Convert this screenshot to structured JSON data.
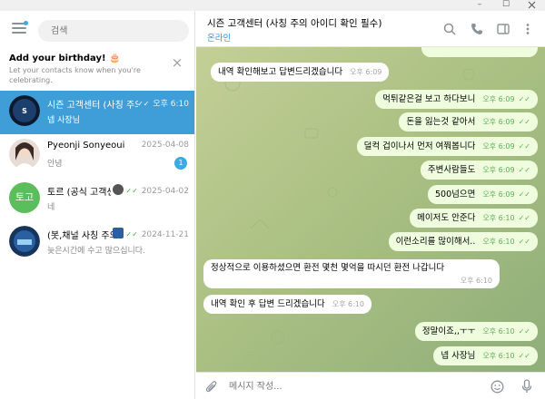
{
  "window": {
    "minimize": "–",
    "maximize": "☐"
  },
  "sidebar": {
    "search_placeholder": "검색",
    "birthday": {
      "title": "Add your birthday! 🎂",
      "text": "Let your contacts know when you're celebrating."
    },
    "chats": [
      {
        "name": "시즌 고객센터 (사칭 주의 아이디 확인 필수)",
        "time": "오후 6:10",
        "message": "넵 사장님",
        "active": true,
        "read": true
      },
      {
        "name": "Pyeonji Sonyeoui",
        "time": "2025-04-08",
        "message": "안녕",
        "unread": "1"
      },
      {
        "name": "토르 (공식 고객센터)",
        "avatar_text": "토고",
        "time": "2025-04-02",
        "message": "네",
        "read": true
      },
      {
        "name": "(봇,채널 사칭 주의)",
        "time": "2024-11-21",
        "message": "늦은시간에 수고 많으십니다.",
        "read": true
      }
    ]
  },
  "header": {
    "title": "시즌 고객센터 (사칭 주의 아이디 확인 필수)",
    "status": "온라인"
  },
  "messages": [
    {
      "dir": "in",
      "text": "내역 확인해보고 답변드리겠습니다",
      "time": "오후 6:09"
    },
    {
      "dir": "out",
      "text": "먹튀같은걸 보고 하다보니",
      "time": "오후 6:09"
    },
    {
      "dir": "out",
      "text": "돈을 잃는것 같아서",
      "time": "오후 6:09"
    },
    {
      "dir": "out",
      "text": "덜컥 겁이나서 먼저 여쭤봅니다",
      "time": "오후 6:09"
    },
    {
      "dir": "out",
      "text": "주변사람들도",
      "time": "오후 6:09"
    },
    {
      "dir": "out",
      "text": "500넘으면",
      "time": "오후 6:09"
    },
    {
      "dir": "out",
      "text": "메이저도 안준다",
      "time": "오후 6:10"
    },
    {
      "dir": "out",
      "text": "이런소리를 많이해서..",
      "time": "오후 6:10"
    },
    {
      "dir": "in",
      "text": "정상적으로 이용하셨으면 환전 몇천 몇억을 따시던 환전 나갑니다",
      "time": "오후 6:10"
    },
    {
      "dir": "in",
      "text": "내역 확인 후 답변 드리겠습니다",
      "time": "오후 6:10"
    },
    {
      "dir": "out",
      "text": "정말이죠,,ㅜㅜ",
      "time": "오후 6:10"
    },
    {
      "dir": "out",
      "text": "넵 사장님",
      "time": "오후 6:10"
    }
  ],
  "composer": {
    "placeholder": "메시지 작성..."
  },
  "colors": {
    "accent": "#3f9ed8",
    "chat_bg": "#b5c58b",
    "out_bubble": "#effdde",
    "read_check": "#5fae59"
  },
  "icons": [
    "menu-icon",
    "close-icon",
    "search-icon",
    "phone-icon",
    "sidebar-toggle-icon",
    "more-icon",
    "attach-icon",
    "emoji-icon",
    "mic-icon"
  ]
}
